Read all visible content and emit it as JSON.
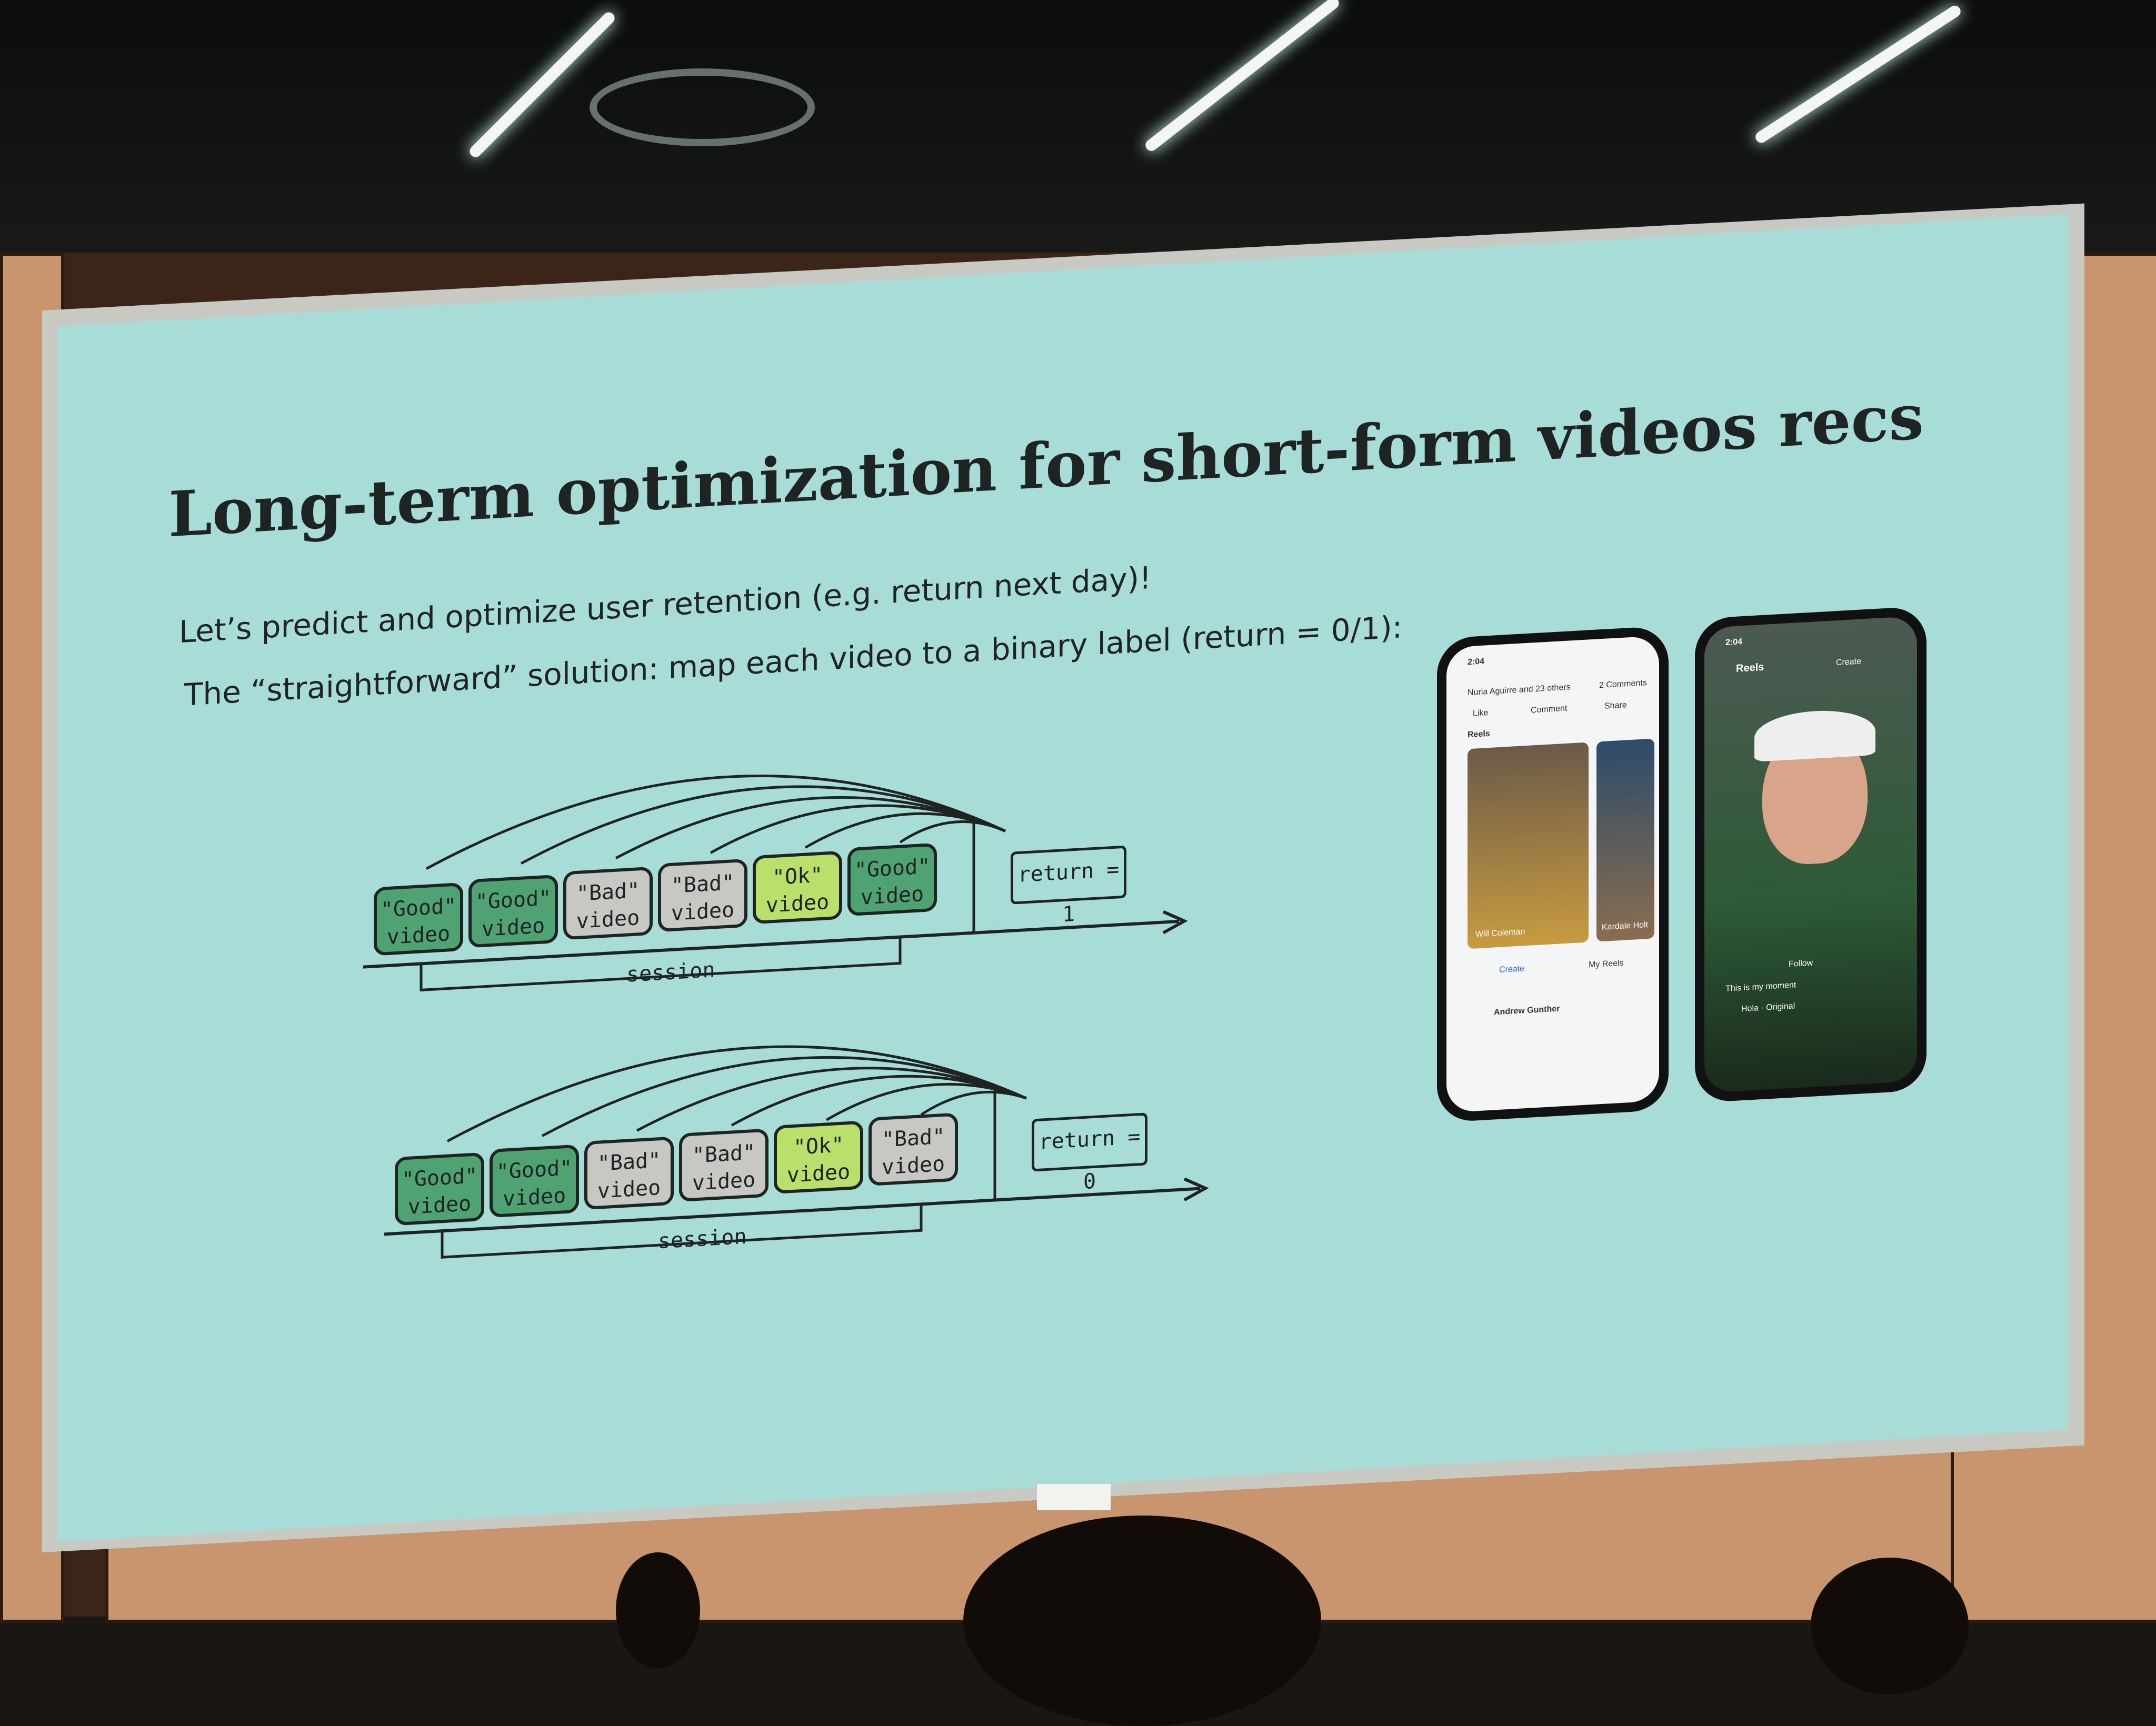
{
  "slide": {
    "title": "Long-term optimization for short-form videos recs",
    "line1": "Let’s predict and optimize user retention (e.g. return next day)!",
    "line2": "The “straightforward” solution: map each video to a binary label (return = 0/1):"
  },
  "diagram_top": {
    "videos": [
      {
        "label": "\"Good\"",
        "sub": "video",
        "kind": "good"
      },
      {
        "label": "\"Good\"",
        "sub": "video",
        "kind": "good"
      },
      {
        "label": "\"Bad\"",
        "sub": "video",
        "kind": "bad"
      },
      {
        "label": "\"Bad\"",
        "sub": "video",
        "kind": "bad"
      },
      {
        "label": "\"Ok\"",
        "sub": "video",
        "kind": "ok"
      },
      {
        "label": "\"Good\"",
        "sub": "video",
        "kind": "good"
      }
    ],
    "return_label": "return = 1",
    "session_label": "session"
  },
  "diagram_bottom": {
    "videos": [
      {
        "label": "\"Good\"",
        "sub": "video",
        "kind": "good"
      },
      {
        "label": "\"Good\"",
        "sub": "video",
        "kind": "good"
      },
      {
        "label": "\"Bad\"",
        "sub": "video",
        "kind": "bad"
      },
      {
        "label": "\"Bad\"",
        "sub": "video",
        "kind": "bad"
      },
      {
        "label": "\"Ok\"",
        "sub": "video",
        "kind": "ok"
      },
      {
        "label": "\"Bad\"",
        "sub": "video",
        "kind": "bad"
      }
    ],
    "return_label": "return = 0",
    "session_label": "session"
  },
  "phone_left": {
    "time": "2:04",
    "reactions": "Nuria Aguirre and 23 others",
    "comments": "2 Comments",
    "like": "Like",
    "comment": "Comment",
    "share": "Share",
    "section": "Reels",
    "card1": "Will Coleman",
    "card2": "Kardale Holt",
    "create": "Create",
    "my_reels": "My Reels",
    "author": "Andrew Gunther"
  },
  "phone_right": {
    "time": "2:04",
    "header": "Reels",
    "create": "Create",
    "follow": "Follow",
    "caption": "This is my moment",
    "audio": "Hola · Original"
  }
}
